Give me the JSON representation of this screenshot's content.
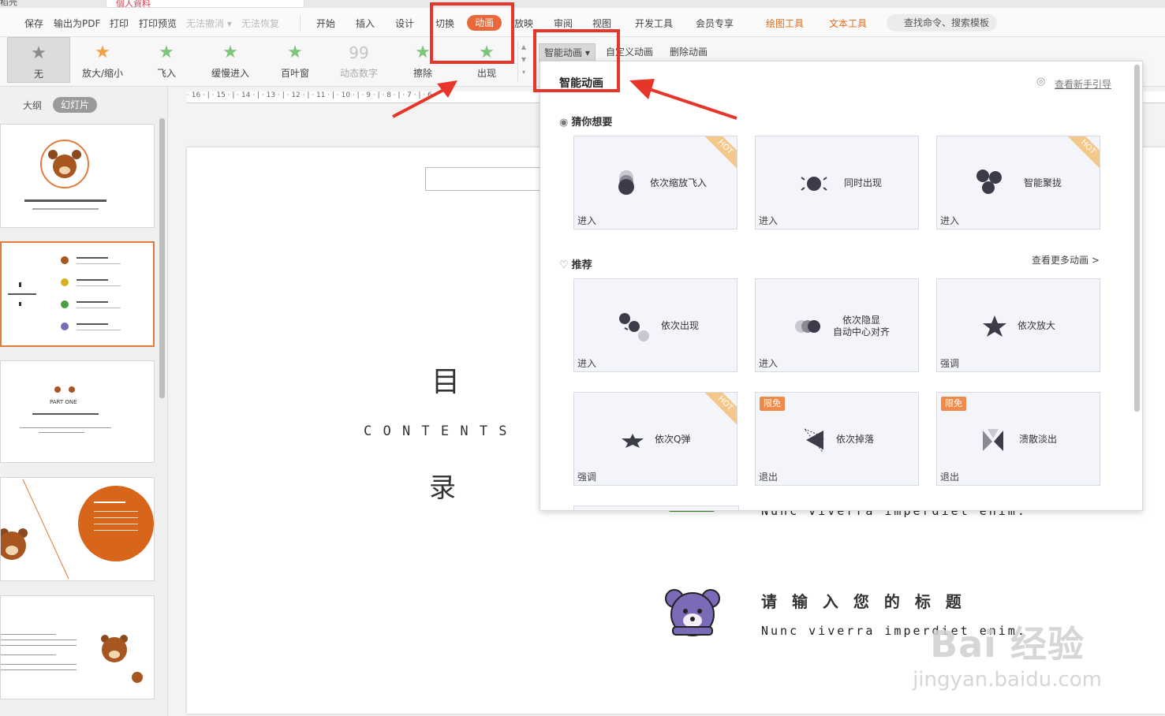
{
  "titlebar": {
    "tab1": "稻壳",
    "tab2": "個人資料"
  },
  "menu": {
    "save": "保存",
    "export_pdf": "输出为PDF",
    "print": "打印",
    "print_preview": "打印预览",
    "undo": "无法撤消",
    "redo": "无法恢复",
    "tabs": [
      "开始",
      "插入",
      "设计",
      "切换",
      "动画",
      "放映",
      "审阅",
      "视图",
      "开发工具",
      "会员专享"
    ],
    "drawing_tools": "绘图工具",
    "text_tools": "文本工具",
    "search_placeholder": "查找命令、搜索模板"
  },
  "ribbon": {
    "gallery": [
      "无",
      "放大/缩小",
      "飞入",
      "缓慢进入",
      "百叶窗",
      "动态数字",
      "擦除",
      "出现"
    ],
    "smart_animation": "智能动画",
    "custom_animation": "自定义动画",
    "delete_animation": "删除动画"
  },
  "left_panel": {
    "outline_tab": "大纲",
    "slides_tab": "幻灯片",
    "thumb3_part": "PART ONE"
  },
  "ruler": "· 16 · | · 15 · | · 14 · | · 13 · | · 12 · | · 11 · | · 10 · | · 9 · | · 8 · | · 7 · | · 6 ·",
  "slide": {
    "mu": "目",
    "contents": "C O N T E N T S",
    "lu": "录",
    "item_title": "请 输 入 您 的 标 题",
    "item_sub": "Nunc viverra imperdiet enim.",
    "partial_line": "Nunc viverra imperdiet enim."
  },
  "popup": {
    "title": "智能动画",
    "guide_link": "查看新手引导",
    "section_guess": "猜你想要",
    "section_recommend": "推荐",
    "more_link": "查看更多动画 >",
    "cards": [
      {
        "name": "依次缩放飞入",
        "tag": "进入",
        "badge": "HOT",
        "icon": "stacked-dots-icon"
      },
      {
        "name": "同时出现",
        "tag": "进入",
        "badge": "",
        "icon": "burst-dot-icon"
      },
      {
        "name": "智能聚拢",
        "tag": "进入",
        "badge": "HOT",
        "icon": "cluster-dots-icon"
      },
      {
        "name": "依次出现",
        "tag": "进入",
        "badge": "",
        "icon": "sequence-dots-icon"
      },
      {
        "name": "依次隐显\n自动中心对齐",
        "tag": "进入",
        "badge": "",
        "icon": "fade-dots-icon"
      },
      {
        "name": "依次放大",
        "tag": "强调",
        "badge": "",
        "icon": "star-icon"
      },
      {
        "name": "依次Q弹",
        "tag": "强调",
        "badge": "HOT",
        "icon": "bounce-star-icon"
      },
      {
        "name": "依次掉落",
        "tag": "退出",
        "badge": "限免",
        "icon": "falling-triangle-icon"
      },
      {
        "name": "溃散淡出",
        "tag": "退出",
        "badge": "限免",
        "icon": "scatter-triangle-icon"
      }
    ]
  },
  "watermark": {
    "line1": "Bai 经验",
    "line2": "jingyan.baidu.com"
  },
  "colors": {
    "accent": "#e9693a",
    "annotation_red": "#e8352a",
    "card_bg": "#f3f5fa",
    "icon_dark": "#3b3b4a"
  }
}
